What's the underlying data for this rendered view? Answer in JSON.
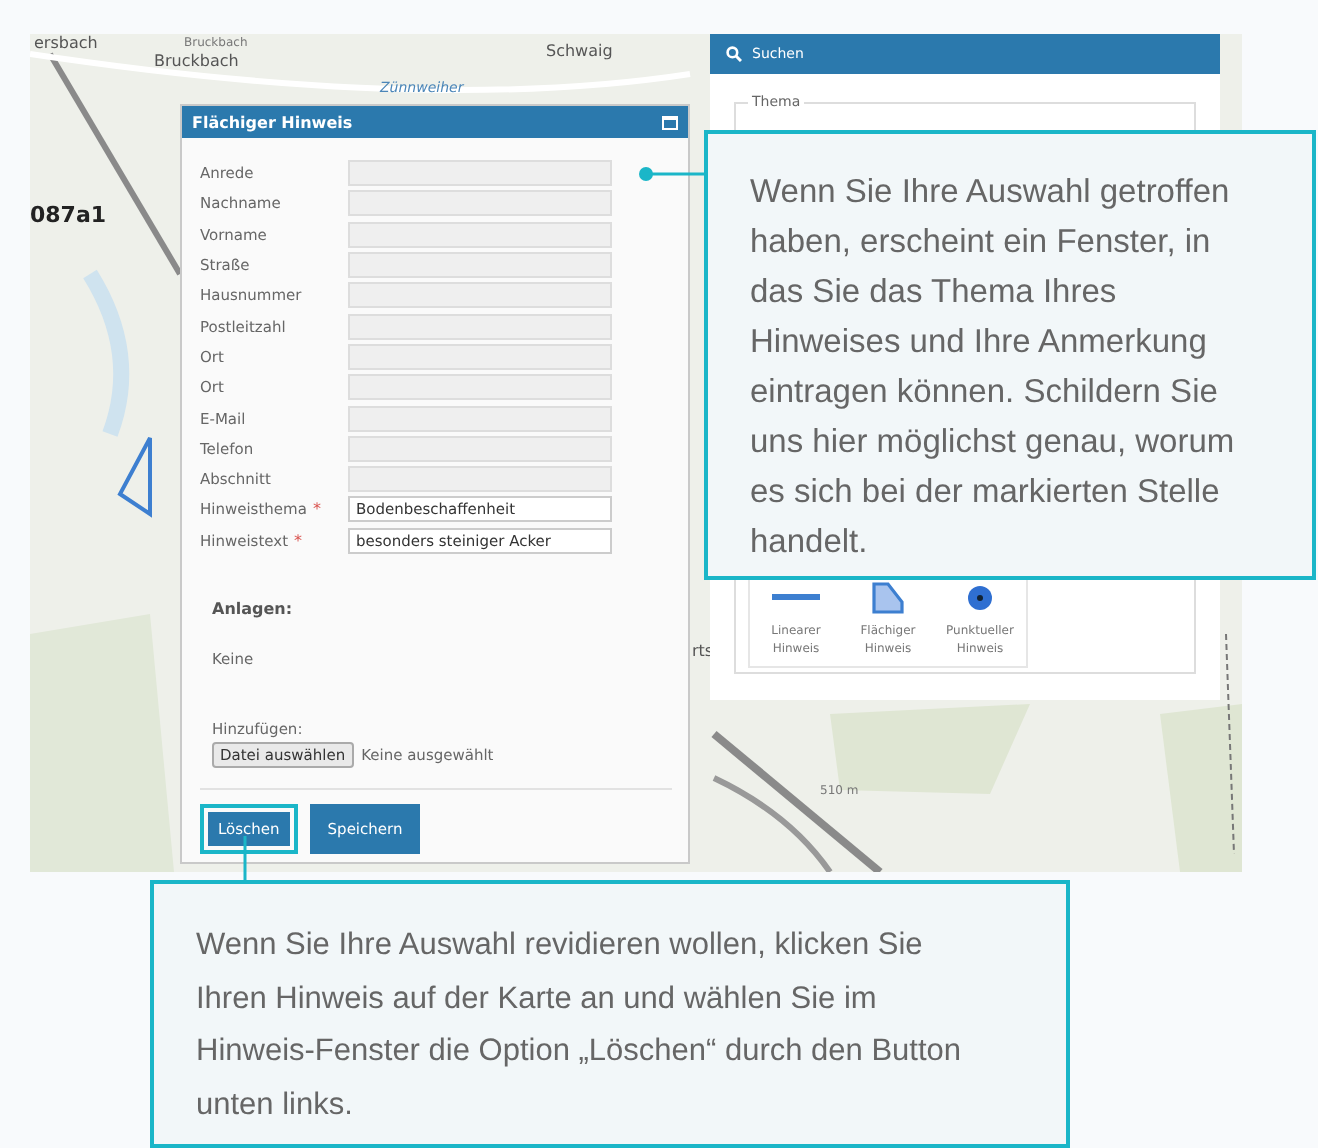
{
  "map": {
    "labels": [
      {
        "text": "ersbach",
        "kind": "place"
      },
      {
        "text": "Bruckbach",
        "kind": "small"
      },
      {
        "text": "Bruckbach",
        "kind": "place"
      },
      {
        "text": "Schwaig",
        "kind": "place"
      },
      {
        "text": "Zünnweiher",
        "kind": "water"
      },
      {
        "text": "087a1",
        "kind": "parcel"
      },
      {
        "text": "rts",
        "kind": "place"
      },
      {
        "text": "510 m",
        "kind": "small"
      }
    ]
  },
  "dialog": {
    "title": "Flächiger Hinweis",
    "fields": [
      {
        "label": "Anrede",
        "disabled": true
      },
      {
        "label": "Nachname",
        "disabled": true
      },
      {
        "label": "Vorname",
        "disabled": true
      },
      {
        "label": "Straße",
        "disabled": true
      },
      {
        "label": "Hausnummer",
        "disabled": true
      },
      {
        "label": "Postleitzahl",
        "disabled": true
      },
      {
        "label": "Ort",
        "disabled": true
      },
      {
        "label": "Ort",
        "disabled": true
      },
      {
        "label": "E-Mail",
        "disabled": true
      },
      {
        "label": "Telefon",
        "disabled": true
      },
      {
        "label": "Abschnitt",
        "disabled": true
      },
      {
        "label": "Hinweisthema",
        "required_mark": "*",
        "disabled": false,
        "value": "Bodenbeschaffenheit"
      },
      {
        "label": "Hinweistext",
        "required_mark": "*",
        "disabled": false,
        "value": "besonders steiniger Acker"
      }
    ],
    "attachments_heading": "Anlagen:",
    "attachments_value": "Keine",
    "add_label": "Hinzufügen:",
    "file_button": "Datei auswählen",
    "file_status": "Keine ausgewählt",
    "buttons": [
      {
        "label": "Löschen",
        "highlighted": true
      },
      {
        "label": "Speichern",
        "highlighted": false
      }
    ]
  },
  "search_panel": {
    "title": "Suchen",
    "legend": "Thema",
    "tools": [
      {
        "kind": "line",
        "label": "Linearer Hinweis"
      },
      {
        "kind": "area",
        "label": "Flächiger Hinweis"
      },
      {
        "kind": "point",
        "label": "Punktueller Hinweis"
      }
    ]
  },
  "callouts": [
    {
      "text": "Wenn Sie Ihre Auswahl getroffen haben, erscheint ein Fenster, in das Sie das Thema Ihres Hinweises und Ihre Anmerkung eintragen können. Schildern Sie uns hier möglichst genau, worum es sich bei der markierten Stelle handelt."
    },
    {
      "text": "Wenn Sie Ihre Auswahl revidieren wollen, klicken Sie Ihren Hinweis auf der Karte an und wählen Sie im Hinweis-Fenster die Option „Löschen“ durch den Button unten links."
    }
  ]
}
